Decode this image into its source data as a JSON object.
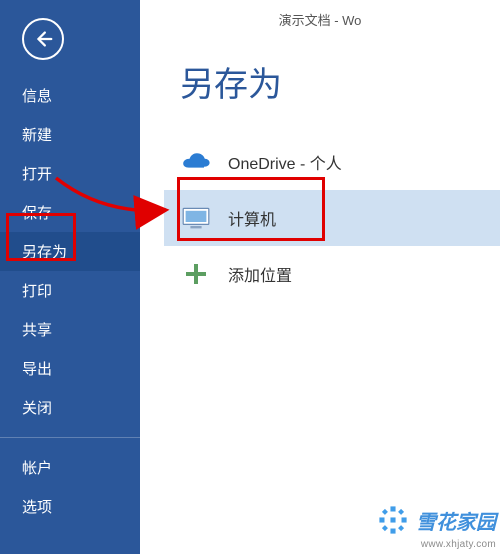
{
  "window_title": "演示文档 - Wo",
  "page_title": "另存为",
  "sidebar": {
    "items": [
      {
        "label": "信息"
      },
      {
        "label": "新建"
      },
      {
        "label": "打开"
      },
      {
        "label": "保存"
      },
      {
        "label": "另存为",
        "selected": true
      },
      {
        "label": "打印"
      },
      {
        "label": "共享"
      },
      {
        "label": "导出"
      },
      {
        "label": "关闭"
      }
    ],
    "bottom_items": [
      {
        "label": "帐户"
      },
      {
        "label": "选项"
      }
    ]
  },
  "options": [
    {
      "icon": "cloud-icon",
      "label": "OneDrive - 个人"
    },
    {
      "icon": "computer-icon",
      "label": "计算机",
      "selected": true
    },
    {
      "icon": "plus-icon",
      "label": "添加位置"
    }
  ],
  "watermark": {
    "brand": "雪花家园",
    "url": "www.xhjaty.com"
  },
  "colors": {
    "accent": "#2b579a",
    "selection": "#cfe0f2",
    "highlight": "#e00000"
  }
}
